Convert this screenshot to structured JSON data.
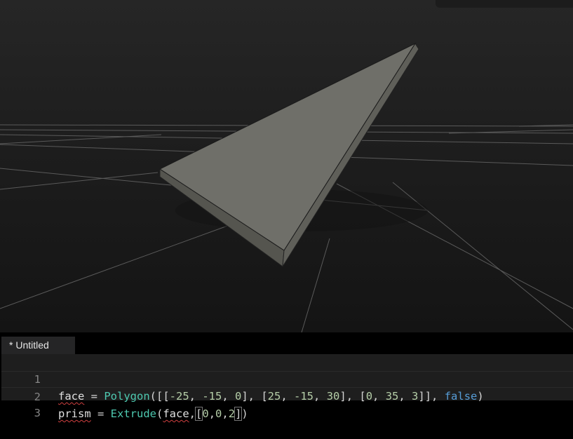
{
  "viewport": {
    "background": "#1e1e1e",
    "shape": "triangular-prism",
    "shape_color": "#6d6d67"
  },
  "editor": {
    "tab_label": "* Untitled",
    "lines": [
      {
        "number": "1",
        "tokens": [
          "face",
          " = ",
          "Polygon",
          "([[",
          "-25",
          ", ",
          "-15",
          ", ",
          "0",
          "], [",
          "25",
          ", ",
          "-15",
          ", ",
          "30",
          "], [",
          "0",
          ", ",
          "35",
          ", ",
          "3",
          "]], ",
          "false",
          ")"
        ]
      },
      {
        "number": "2",
        "tokens": [
          "prism",
          " = ",
          "Extrude",
          "(",
          "face",
          ",",
          "[",
          "0",
          ",",
          "0",
          ",",
          "2",
          "]",
          ")"
        ]
      },
      {
        "number": "3",
        "tokens": []
      }
    ]
  },
  "colors": {
    "function": "#4ec9b0",
    "number": "#b5cea8",
    "keyword": "#569cd6",
    "error_underline": "#d04040"
  }
}
